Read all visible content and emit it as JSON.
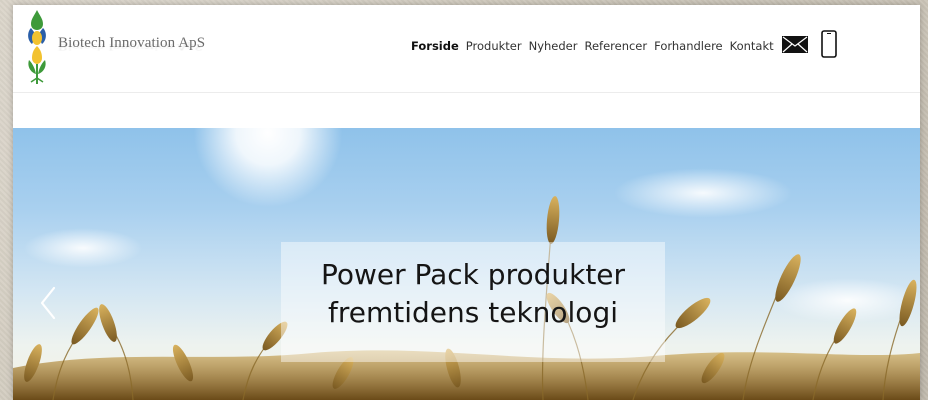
{
  "header": {
    "brand_name": "Biotech Innovation ApS",
    "nav": [
      {
        "label": "Forside",
        "active": true
      },
      {
        "label": "Produkter",
        "active": false
      },
      {
        "label": "Nyheder",
        "active": false
      },
      {
        "label": "Referencer",
        "active": false
      },
      {
        "label": "Forhandlere",
        "active": false
      },
      {
        "label": "Kontakt",
        "active": false
      }
    ],
    "icons": [
      "mail-icon",
      "phone-icon"
    ]
  },
  "hero": {
    "caption_line1": "Power Pack produkter",
    "caption_line2": "fremtidens teknologi",
    "prev_icon": "chevron-left-icon"
  },
  "colors": {
    "sky_top": "#8fc2ea",
    "sky_bottom": "#f4efe2",
    "wheat": "#c9a04a",
    "logo_green": "#3e9a3a",
    "logo_yellow": "#f2c230",
    "logo_blue": "#2a5ea8"
  }
}
